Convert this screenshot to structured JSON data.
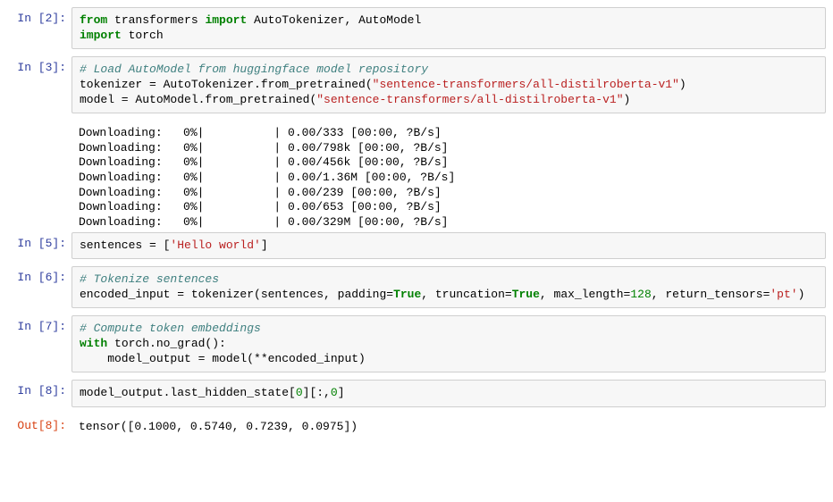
{
  "cells": [
    {
      "type": "code",
      "prompt": "In [2]:",
      "tokens": [
        [
          "k-from",
          "from"
        ],
        [
          "",
          " transformers "
        ],
        [
          "k-import",
          "import"
        ],
        [
          "",
          " AutoTokenizer, AutoModel\n"
        ],
        [
          "k-import",
          "import"
        ],
        [
          "",
          " torch"
        ]
      ]
    },
    {
      "type": "code",
      "prompt": "In [3]:",
      "tokens": [
        [
          "cm",
          "# Load AutoModel from huggingface model repository"
        ],
        [
          "",
          "\n"
        ],
        [
          "",
          "tokenizer = AutoTokenizer.from_pretrained("
        ],
        [
          "st",
          "\"sentence-transformers/all-distilroberta-v1\""
        ],
        [
          "",
          ")\n"
        ],
        [
          "",
          "model = AutoModel.from_pretrained("
        ],
        [
          "st",
          "\"sentence-transformers/all-distilroberta-v1\""
        ],
        [
          "",
          ")"
        ]
      ],
      "stdout": "Downloading:   0%|          | 0.00/333 [00:00, ?B/s]\nDownloading:   0%|          | 0.00/798k [00:00, ?B/s]\nDownloading:   0%|          | 0.00/456k [00:00, ?B/s]\nDownloading:   0%|          | 0.00/1.36M [00:00, ?B/s]\nDownloading:   0%|          | 0.00/239 [00:00, ?B/s]\nDownloading:   0%|          | 0.00/653 [00:00, ?B/s]\nDownloading:   0%|          | 0.00/329M [00:00, ?B/s]"
    },
    {
      "type": "code",
      "prompt": "In [5]:",
      "tokens": [
        [
          "",
          "sentences = ["
        ],
        [
          "st",
          "'Hello world'"
        ],
        [
          "",
          "]"
        ]
      ]
    },
    {
      "type": "code",
      "prompt": "In [6]:",
      "tokens": [
        [
          "cm",
          "# Tokenize sentences"
        ],
        [
          "",
          "\n"
        ],
        [
          "",
          "encoded_input = tokenizer(sentences, padding="
        ],
        [
          "bval",
          "True"
        ],
        [
          "",
          ", truncation="
        ],
        [
          "bval",
          "True"
        ],
        [
          "",
          ", max_length="
        ],
        [
          "num",
          "128"
        ],
        [
          "",
          ", return_tensors="
        ],
        [
          "st",
          "'pt'"
        ],
        [
          "",
          ")"
        ]
      ]
    },
    {
      "type": "code",
      "prompt": "In [7]:",
      "tokens": [
        [
          "cm",
          "# Compute token embeddings"
        ],
        [
          "",
          "\n"
        ],
        [
          "k-with",
          "with"
        ],
        [
          "",
          " torch.no_grad():\n"
        ],
        [
          "",
          "    model_output = model(**encoded_input)"
        ]
      ]
    },
    {
      "type": "code",
      "prompt": "In [8]:",
      "tokens": [
        [
          "",
          "model_output.last_hidden_state["
        ],
        [
          "num",
          "0"
        ],
        [
          "",
          "][:,"
        ],
        [
          "num",
          "0"
        ],
        [
          "",
          "]"
        ]
      ]
    },
    {
      "type": "out",
      "prompt": "Out[8]:",
      "text": "tensor([0.1000, 0.5740, 0.7239, 0.0975])"
    }
  ]
}
